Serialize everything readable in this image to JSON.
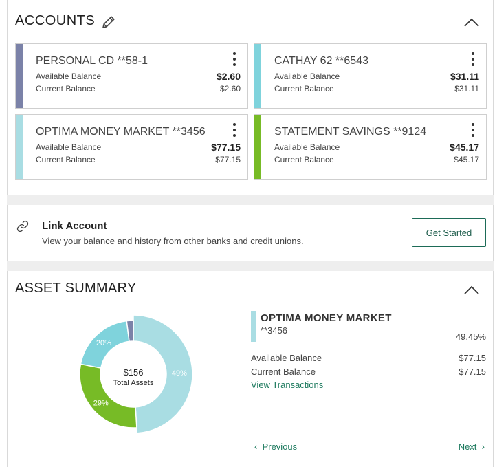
{
  "accounts_section": {
    "title": "ACCOUNTS",
    "cards": [
      {
        "name": "PERSONAL CD **58-1",
        "available_label": "Available Balance",
        "available_value": "$2.60",
        "current_label": "Current Balance",
        "current_value": "$2.60",
        "color": "#7b82a8"
      },
      {
        "name": "CATHAY 62 **6543",
        "available_label": "Available Balance",
        "available_value": "$31.11",
        "current_label": "Current Balance",
        "current_value": "$31.11",
        "color": "#7fd3dc"
      },
      {
        "name": "OPTIMA MONEY MARKET **3456",
        "available_label": "Available Balance",
        "available_value": "$77.15",
        "current_label": "Current Balance",
        "current_value": "$77.15",
        "color": "#a9dde3"
      },
      {
        "name": "STATEMENT SAVINGS **9124",
        "available_label": "Available Balance",
        "available_value": "$45.17",
        "current_label": "Current Balance",
        "current_value": "$45.17",
        "color": "#77bb26"
      }
    ]
  },
  "link_account": {
    "title": "Link Account",
    "description": "View your balance and history from other banks and credit unions.",
    "button_label": "Get Started"
  },
  "asset_summary": {
    "title": "ASSET SUMMARY",
    "chart": {
      "total_value": "$156",
      "total_label": "Total Assets",
      "slices": [
        {
          "account": "OPTIMA MONEY MARKET **3456",
          "percent": 49,
          "label": "49%",
          "color": "#a9dde3"
        },
        {
          "account": "STATEMENT SAVINGS **9124",
          "percent": 29,
          "label": "29%",
          "color": "#77bb26"
        },
        {
          "account": "CATHAY 62 **6543",
          "percent": 20,
          "label": "20%",
          "color": "#7fd3dc"
        },
        {
          "account": "PERSONAL CD **58-1",
          "percent": 2,
          "label": "",
          "color": "#7b82a8"
        }
      ]
    },
    "selected": {
      "name": "OPTIMA MONEY MARKET",
      "number": "**3456",
      "percent": "49.45%",
      "available_label": "Available Balance",
      "available_value": "$77.15",
      "current_label": "Current Balance",
      "current_value": "$77.15",
      "view_transactions": "View Transactions"
    },
    "pager": {
      "previous": "Previous",
      "next": "Next"
    }
  },
  "icons": {
    "edit": "pencil-icon",
    "collapse": "chevron-up-icon",
    "more": "kebab-icon",
    "link": "link-icon"
  }
}
